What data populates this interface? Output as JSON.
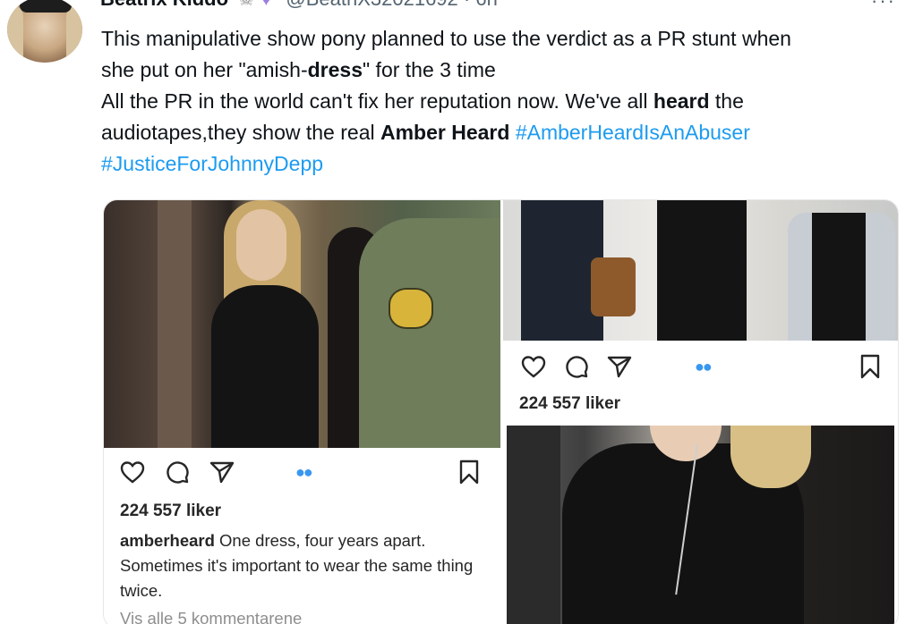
{
  "tweet": {
    "name": "Beatrix Kiddo",
    "emoji": "☠",
    "heart": "♥",
    "handle": "@BeatriX32021692 · 6h",
    "more": "···",
    "line1": "This manipulative show pony planned to use the verdict as a PR stunt when",
    "line2_pre": "she put on her \"amish-",
    "line2_bold": "dress",
    "line2_post": "\" for the 3 time",
    "line3_pre": "All the PR in the world can't fix her reputation now. We've all ",
    "line3_bold": "heard",
    "line3_post": " the",
    "line4_pre": "audiotapes,they show the real ",
    "line4_bold": "Amber Heard",
    "hashtag1": "#AmberHeardIsAnAbuser",
    "hashtag2": "#JusticeForJohnnyDepp"
  },
  "instagram_left": {
    "likes": "224 557 liker",
    "username": "amberheard",
    "caption": " One dress, four years apart. Sometimes it's important to wear the same thing twice.",
    "view_all": "Vis alle 5 kommentarene"
  },
  "instagram_right": {
    "likes": "224 557 liker"
  },
  "icons": {
    "like": "heart-outline-icon",
    "comment": "comment-bubble-icon",
    "share": "paper-plane-icon",
    "save": "bookmark-icon",
    "carousel": "carousel-dots-icon"
  },
  "colors": {
    "link": "#1d9bf0",
    "ig_dots": "#3897f0",
    "text": "#0f1419"
  }
}
